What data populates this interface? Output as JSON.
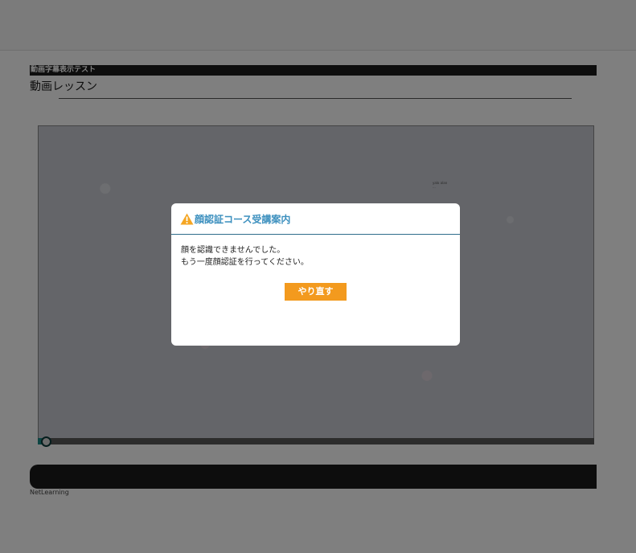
{
  "course": {
    "name": "動画字幕表示テスト"
  },
  "lesson": {
    "title": "動画レッスン"
  },
  "player": {
    "note_line1": "yalo alan",
    "note_line2": "..."
  },
  "footer": {
    "brand": "NetLearning"
  },
  "modal": {
    "icon": "warning-triangle-icon",
    "title": "顔認証コース受講案内",
    "message_line1": "顔を認識できませんでした。",
    "message_line2": "もう一度顔認証を行ってください。",
    "retry_label": "やり直す"
  },
  "colors": {
    "accent_orange": "#f39a1e",
    "title_blue": "#3b8fbe",
    "warning_yellow": "#f5a623"
  }
}
